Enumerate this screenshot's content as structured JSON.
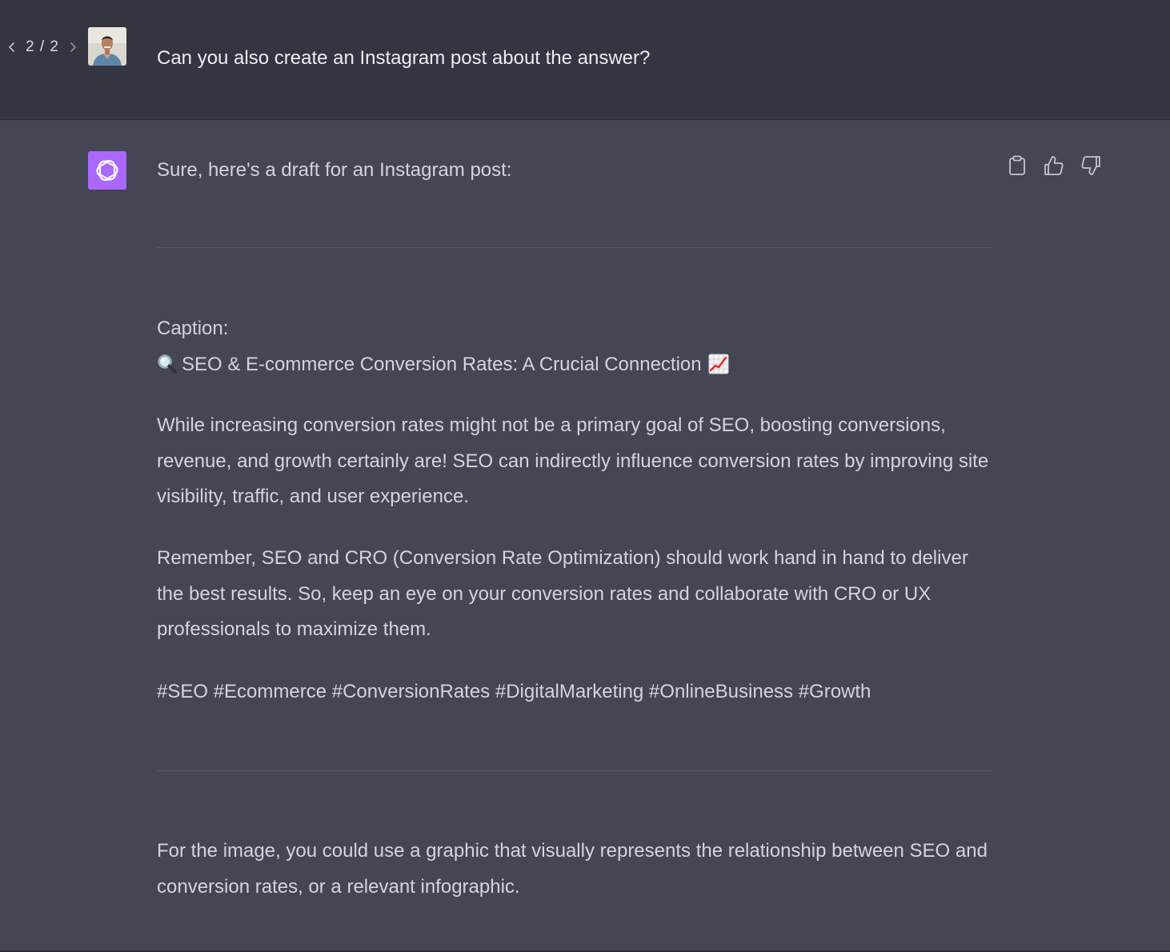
{
  "conversation": {
    "user_message": {
      "pager": {
        "count": "2 / 2",
        "prev_icon": "chevron-left-icon",
        "next_icon": "chevron-right-icon"
      },
      "text": "Can you also create an Instagram post about the answer?"
    },
    "assistant_message": {
      "intro": "Sure, here's a draft for an Instagram post:",
      "caption_label": "Caption:",
      "caption_title": "SEO & E-commerce Conversion Rates: A Crucial Connection",
      "title_icons": [
        "magnifying-glass-emoji",
        "chart-increasing-emoji"
      ],
      "paragraph_1": "While increasing conversion rates might not be a primary goal of SEO, boosting conversions, revenue, and growth certainly are! SEO can indirectly influence conversion rates by improving site visibility, traffic, and user experience.",
      "paragraph_2": "Remember, SEO and CRO (Conversion Rate Optimization) should work hand in hand to deliver the best results. So, keep an eye on your conversion rates and collaborate with CRO or UX professionals to maximize them.",
      "hashtags": "#SEO #Ecommerce #ConversionRates #DigitalMarketing #OnlineBusiness #Growth",
      "image_suggestion": "For the image, you could use a graphic that visually represents the relationship between SEO and conversion rates, or a relevant infographic.",
      "actions": [
        "clipboard-icon",
        "thumbs-up-icon",
        "thumbs-down-icon"
      ]
    }
  },
  "colors": {
    "user_bg": "#343541",
    "assistant_bg": "#444654",
    "bot_avatar": "#ab68ff",
    "text": "#d1d5db"
  }
}
